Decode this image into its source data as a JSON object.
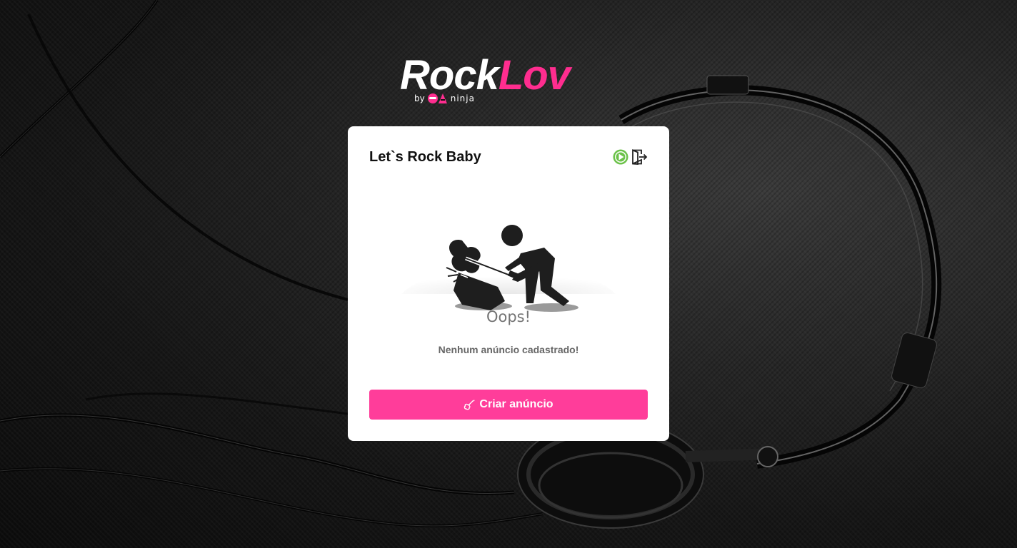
{
  "brand": {
    "name_part1": "Rock",
    "name_part2": "Lov",
    "by": "by",
    "partner": "ninja",
    "accent_color": "#ff2d8f"
  },
  "card": {
    "title": "Let`s Rock Baby",
    "icons": [
      "play-circle-icon",
      "logout-icon"
    ],
    "empty_state": {
      "headline": "Oops!",
      "message": "Nenhum anúncio cadastrado!"
    },
    "button": {
      "label": "Criar anúncio",
      "icon": "guitar-icon",
      "color": "#ff3d9a"
    }
  }
}
